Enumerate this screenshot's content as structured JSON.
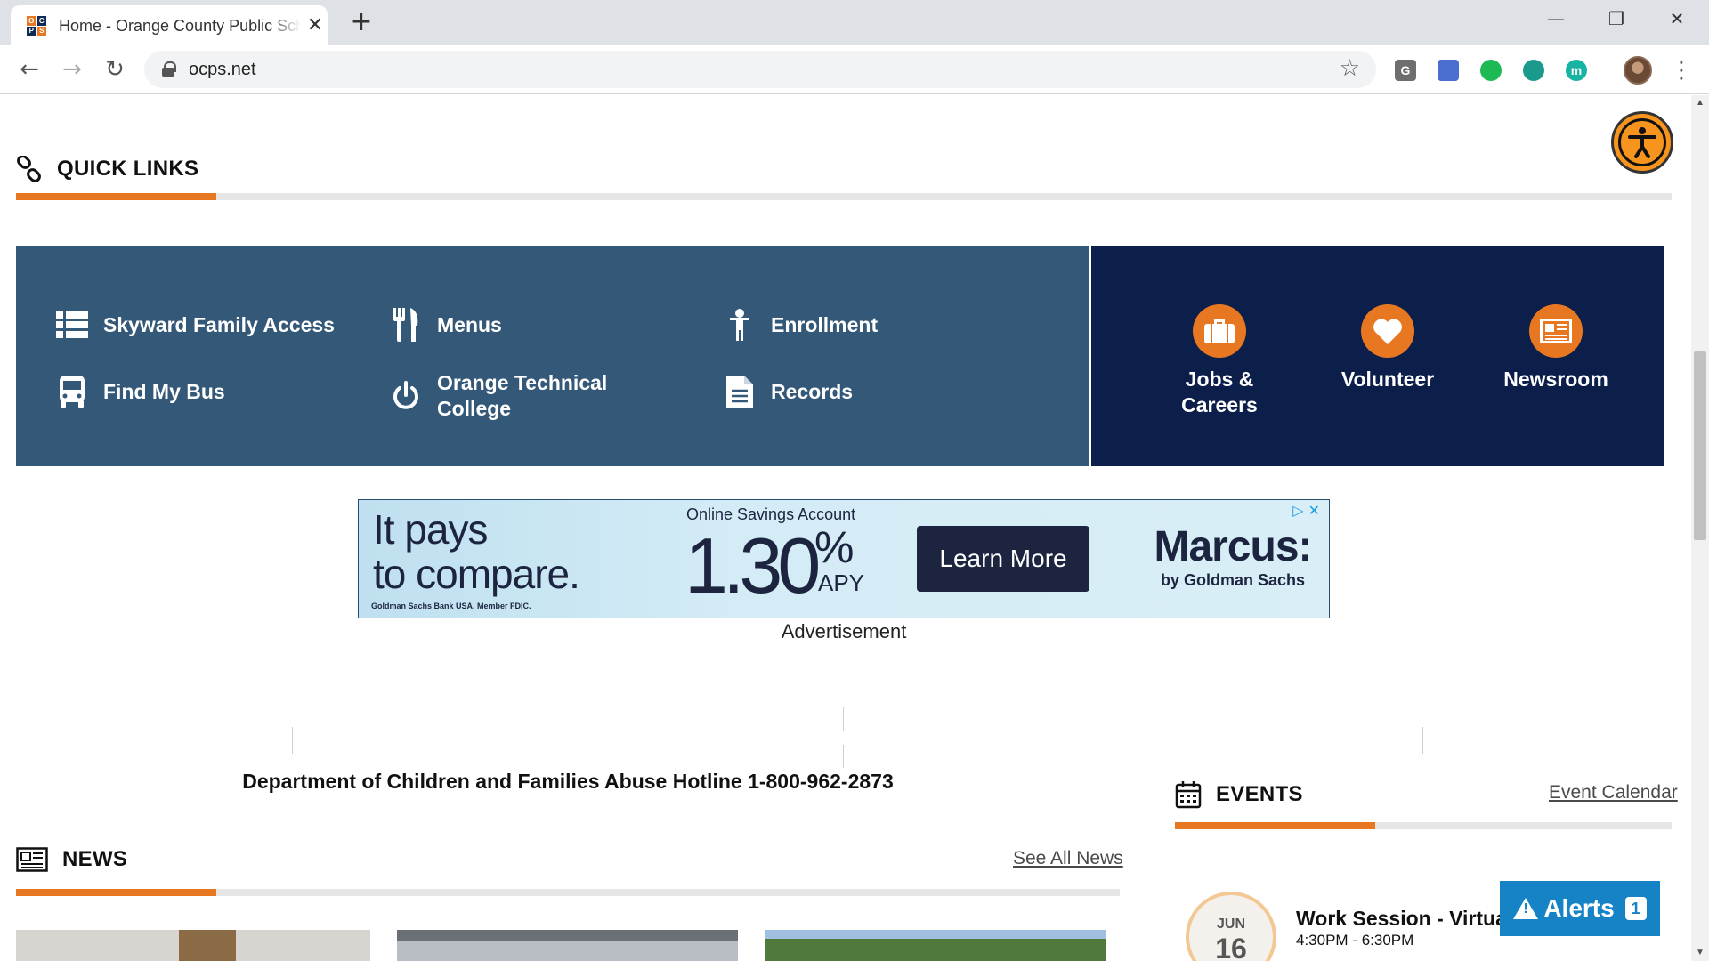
{
  "browser": {
    "tab_title": "Home - Orange County Public Schools",
    "favicon_letters": [
      "O",
      "C",
      "P",
      "S"
    ],
    "url": "ocps.net",
    "window_controls": [
      "—",
      "❐",
      "✕"
    ]
  },
  "extensions": [
    {
      "name": "g-extension-icon",
      "label": "G",
      "color": "#6e6e6e"
    },
    {
      "name": "camera-extension-icon",
      "label": "",
      "color": "#4a6fd1"
    },
    {
      "name": "refresh-extension-icon",
      "label": "",
      "color": "#1db954"
    },
    {
      "name": "globe-extension-icon",
      "label": "",
      "color": "#1a9a8a"
    },
    {
      "name": "m-extension-icon",
      "label": "m",
      "color": "#17b3a3"
    }
  ],
  "quick_links": {
    "title": "QUICK LINKS",
    "items": [
      {
        "label": "Skyward Family Access",
        "icon": "list-icon"
      },
      {
        "label": "Menus",
        "icon": "utensils-icon"
      },
      {
        "label": "Enrollment",
        "icon": "child-icon"
      },
      {
        "label": "Find My Bus",
        "icon": "bus-icon"
      },
      {
        "label": "Orange Technical College",
        "icon": "power-icon"
      },
      {
        "label": "Records",
        "icon": "document-icon"
      }
    ],
    "featured": [
      {
        "label": "Jobs & Careers",
        "icon": "briefcase-icon"
      },
      {
        "label": "Volunteer",
        "icon": "heart-icon"
      },
      {
        "label": "Newsroom",
        "icon": "newspaper-icon"
      }
    ]
  },
  "ad": {
    "headline_1": "It pays",
    "headline_2": "to compare.",
    "subtitle": "Online Savings Account",
    "rate": "1.30",
    "percent": "%",
    "apy": "APY",
    "cta": "Learn More",
    "brand": "Marcus:",
    "brand_sub": "by Goldman Sachs",
    "fine_print": "Goldman Sachs Bank USA. Member FDIC.",
    "label": "Advertisement"
  },
  "hotline": "Department of Children and Families Abuse Hotline 1-800-962-2873",
  "news": {
    "title": "NEWS",
    "see_all": "See All News"
  },
  "events": {
    "title": "EVENTS",
    "calendar_link": "Event Calendar",
    "items": [
      {
        "month": "JUN",
        "day": "16",
        "title": "Work Session - Virtual",
        "time": "4:30PM - 6:30PM"
      }
    ]
  },
  "alerts": {
    "label": "Alerts",
    "count": "1"
  },
  "colors": {
    "accent_orange": "#e87722",
    "quicklinks_blue": "#345878",
    "featured_navy": "#0b1f4a",
    "alerts_blue": "#1683c6"
  }
}
